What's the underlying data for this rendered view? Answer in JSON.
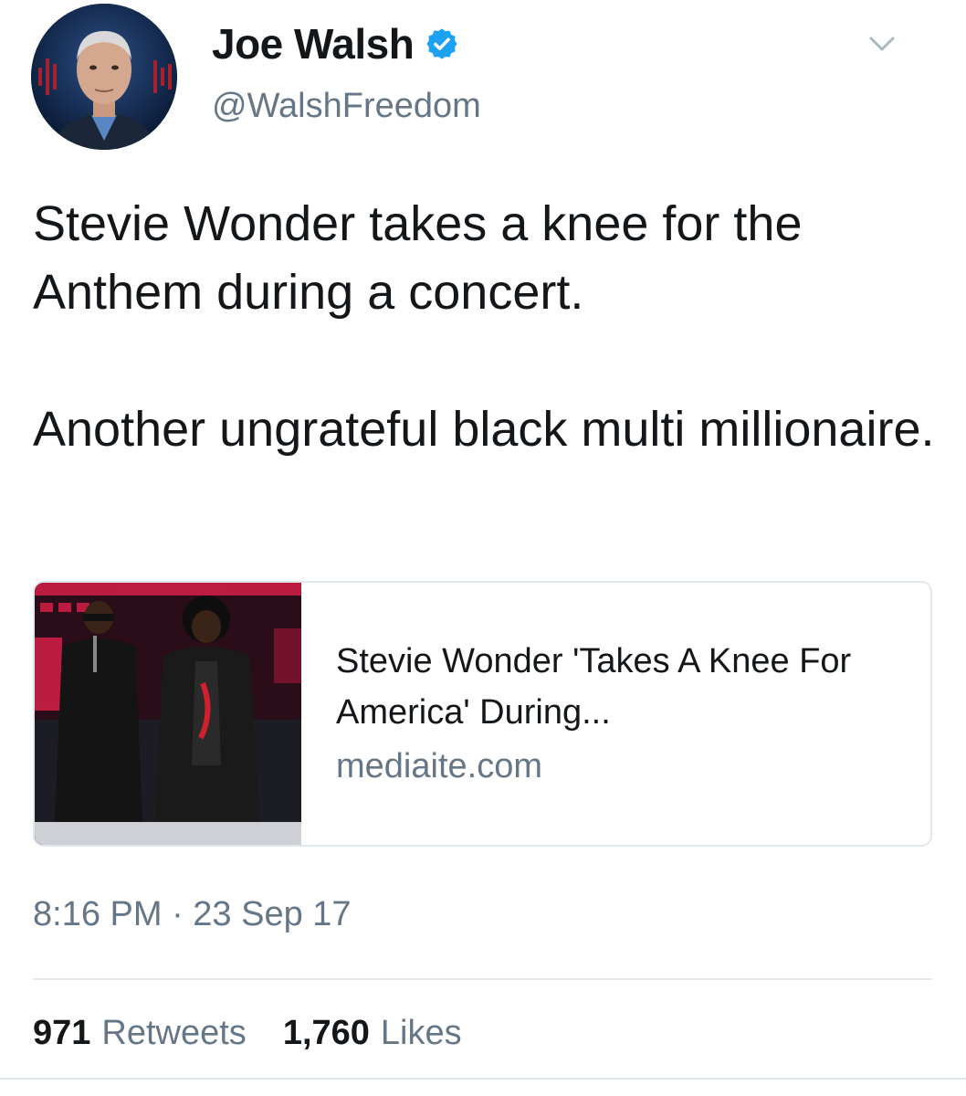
{
  "user": {
    "display_name": "Joe Walsh",
    "handle": "@WalshFreedom",
    "verified_icon": "verified-badge-icon",
    "avatar_icon": "profile-avatar"
  },
  "tweet": {
    "paragraphs": [
      "Stevie Wonder takes a knee for the Anthem during a concert.",
      "Another ungrateful black multi millionaire."
    ]
  },
  "card": {
    "title": "Stevie Wonder 'Takes A Knee For America' During...",
    "domain": "mediaite.com"
  },
  "meta": {
    "timestamp": "8:16 PM · 23 Sep 17"
  },
  "stats": {
    "retweets_count": "971",
    "retweets_label": "Retweets",
    "likes_count": "1,760",
    "likes_label": "Likes"
  },
  "colors": {
    "verified_blue": "#1da1f2",
    "secondary_text": "#657786",
    "primary_text": "#14171a",
    "border": "#e1e8ed"
  }
}
